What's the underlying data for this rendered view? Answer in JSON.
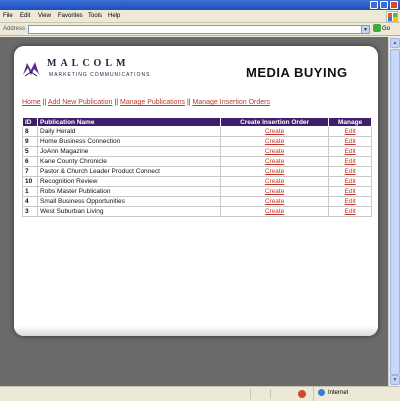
{
  "browser": {
    "menu": [
      "File",
      "Edit",
      "View",
      "Favorites",
      "Tools",
      "Help"
    ],
    "address_label": "Address",
    "address_value": "",
    "go_label": "Go",
    "status_zone": "Internet"
  },
  "brand": {
    "name": "MALCOLM",
    "subtitle": "MARKETING COMMUNICATIONS"
  },
  "page": {
    "title": "MEDIA BUYING"
  },
  "nav": {
    "home": "Home",
    "add_new": "Add New Publication",
    "manage_pubs": "Manage Publications",
    "manage_orders": "Manage Insertion Orders",
    "separator": "||"
  },
  "table": {
    "headers": [
      "ID",
      "Publication Name",
      "Create Insertion Order",
      "Manage"
    ],
    "rows": [
      {
        "id": "8",
        "name": "Daily Herald",
        "create": "Create",
        "manage": "Edit"
      },
      {
        "id": "9",
        "name": "Home Business Connection",
        "create": "Create",
        "manage": "Edit"
      },
      {
        "id": "5",
        "name": "JoAnn Magazine",
        "create": "Create",
        "manage": "Edit"
      },
      {
        "id": "6",
        "name": "Kane County Chronicle",
        "create": "Create",
        "manage": "Edit"
      },
      {
        "id": "7",
        "name": "Pastor & Church Leader Product Connect",
        "create": "Create",
        "manage": "Edit"
      },
      {
        "id": "10",
        "name": "Recognition Review",
        "create": "Create",
        "manage": "Edit"
      },
      {
        "id": "1",
        "name": "Robs Master Publication",
        "create": "Create",
        "manage": "Edit"
      },
      {
        "id": "4",
        "name": "Small Business Opportunities",
        "create": "Create",
        "manage": "Edit"
      },
      {
        "id": "3",
        "name": "West Suburban Living",
        "create": "Create",
        "manage": "Edit"
      }
    ]
  },
  "colors": {
    "header_bg": "#3f1f6b",
    "link": "#c0392b",
    "chrome": "#ece9d8"
  }
}
